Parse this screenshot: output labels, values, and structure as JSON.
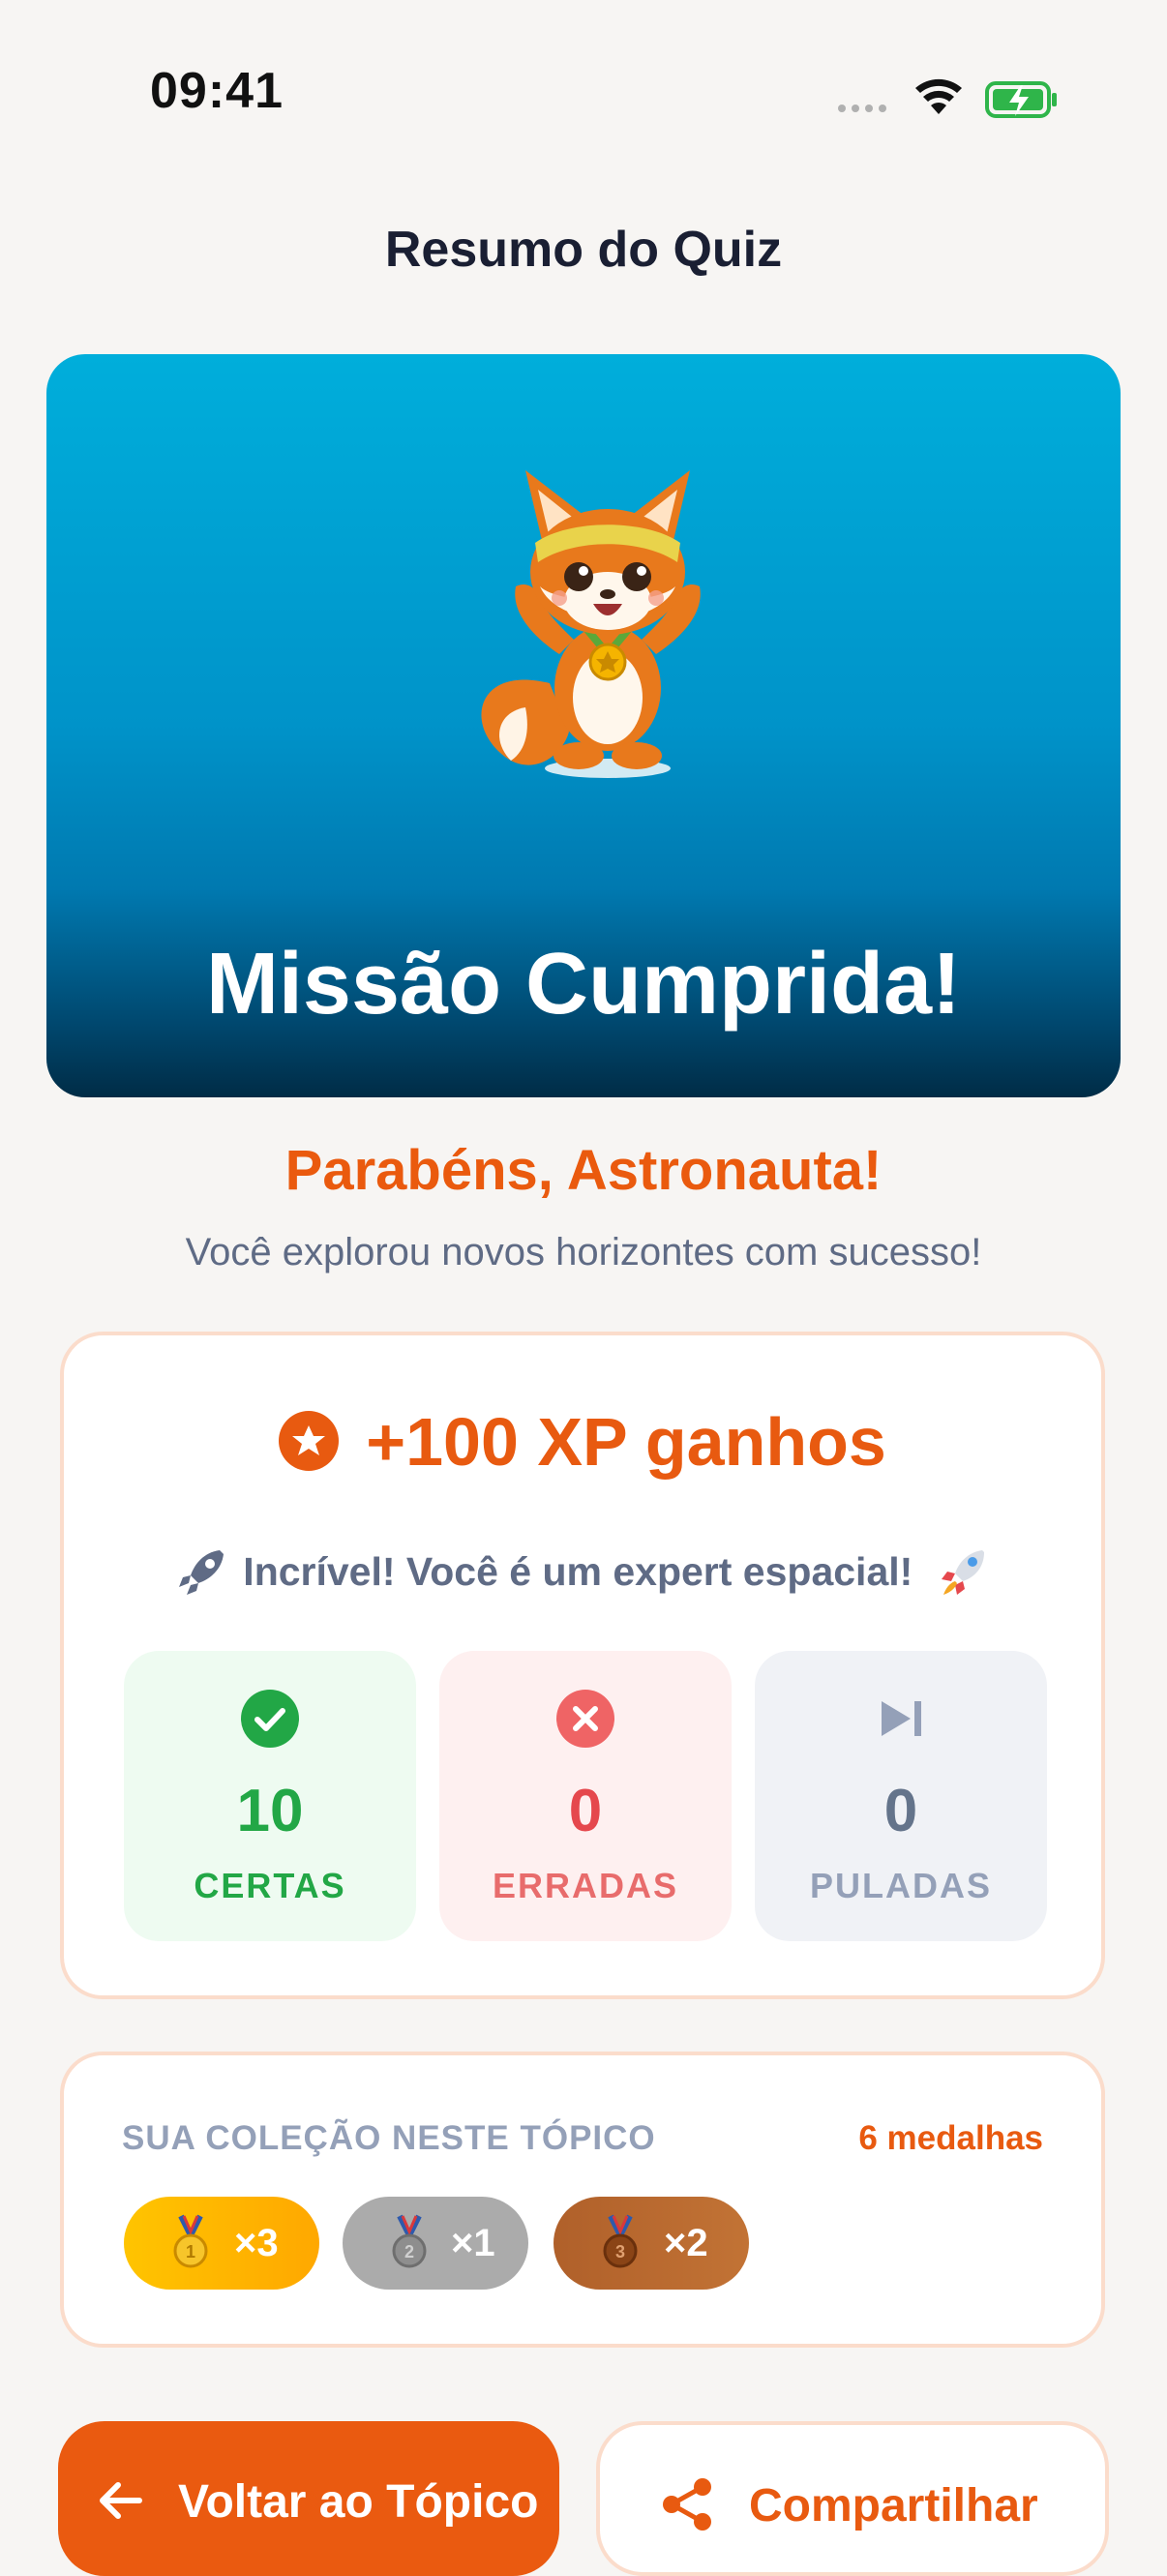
{
  "status_bar": {
    "time": "09:41"
  },
  "header": {
    "title": "Resumo do Quiz"
  },
  "hero": {
    "title": "Missão Cumprida!",
    "mascot_icon": "fox-mascot-icon"
  },
  "greeting": {
    "title": "Parabéns, Astronauta!",
    "subtitle": "Você explorou novos horizontes com sucesso!"
  },
  "xp": {
    "amount": "+100 XP ganhos",
    "message": "Incrível! Você é um expert espacial!",
    "stats": [
      {
        "value": "10",
        "label": "CERTAS",
        "icon": "check-circle-icon",
        "color": "#22A746"
      },
      {
        "value": "0",
        "label": "ERRADAS",
        "icon": "x-circle-icon",
        "color": "#E5484D"
      },
      {
        "value": "0",
        "label": "PULADAS",
        "icon": "skip-next-icon",
        "color": "#64748B"
      }
    ]
  },
  "collection": {
    "title": "SUA COLEÇÃO NESTE TÓPICO",
    "count": "6 medalhas",
    "medals": [
      {
        "name": "gold",
        "count": "×3",
        "color": "#F5B400"
      },
      {
        "name": "silver",
        "count": "×1",
        "color": "#A9A9A9"
      },
      {
        "name": "bronze",
        "count": "×2",
        "color": "#B4622C"
      }
    ]
  },
  "actions": {
    "back_label": "Voltar ao Tópico",
    "share_label": "Compartilhar"
  },
  "colors": {
    "accent": "#EA5A10",
    "background": "#F7F5F3"
  }
}
